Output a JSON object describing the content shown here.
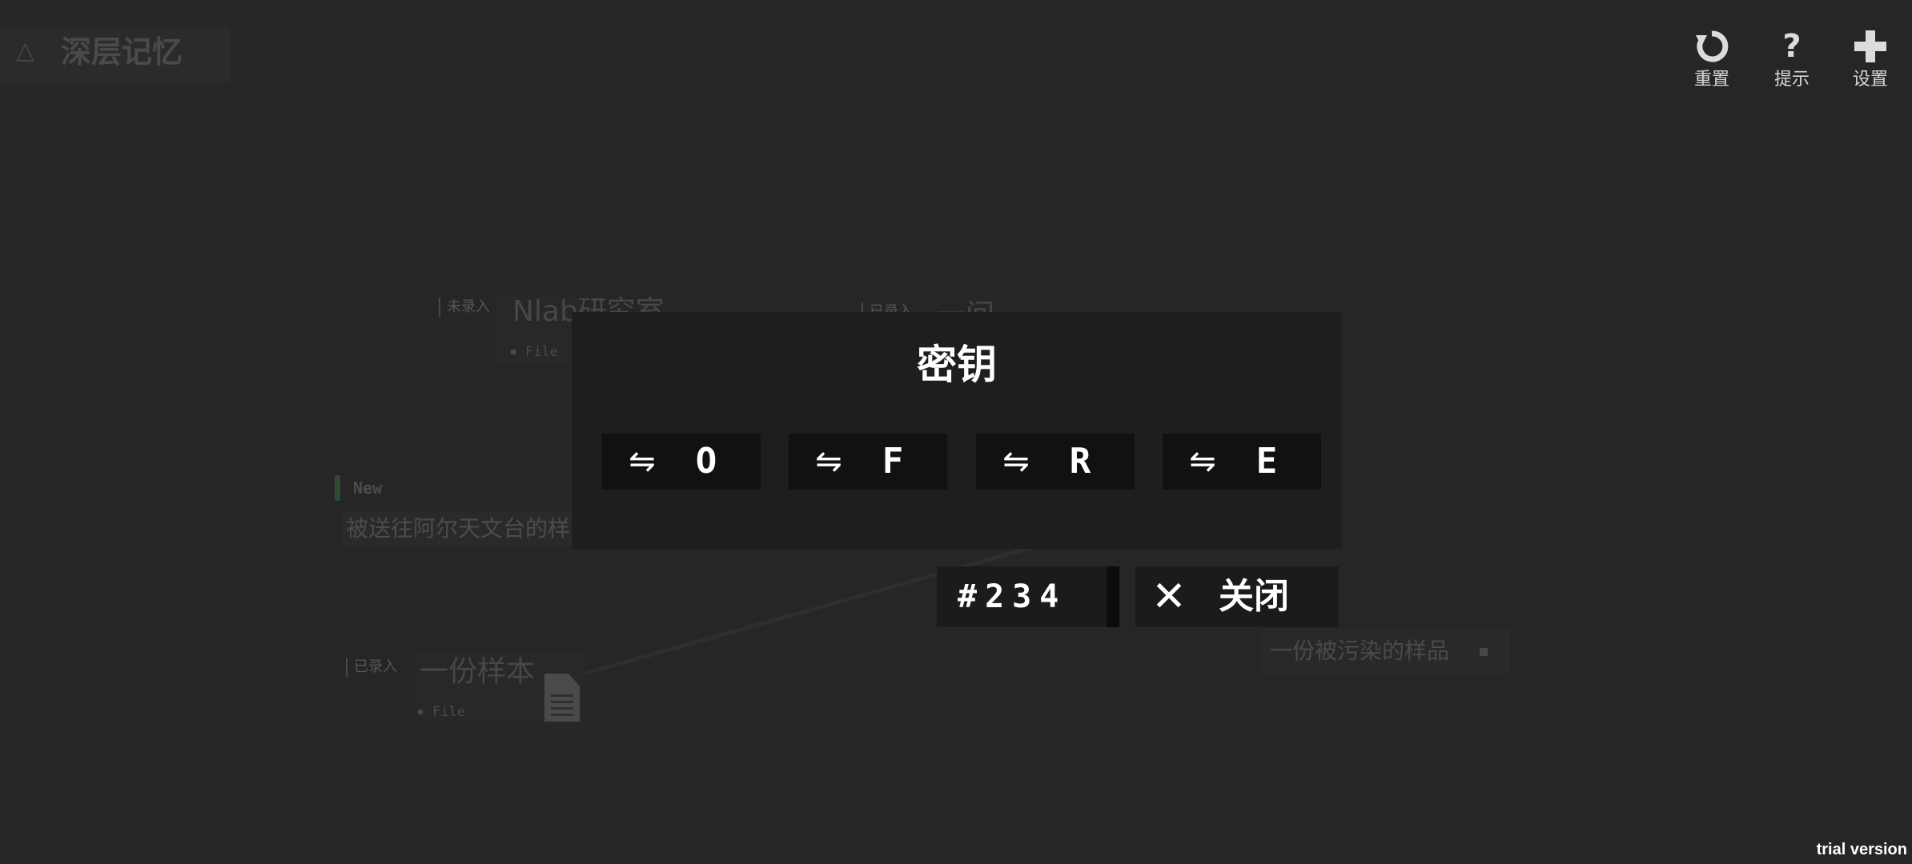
{
  "header": {
    "title": "深层记忆",
    "title_icon": "triangle-outline-icon"
  },
  "toolbar": {
    "reset_label": "重置",
    "hint_label": "提示",
    "settings_label": "设置",
    "reset_icon": "refresh-icon",
    "hint_icon": "question-icon",
    "settings_icon": "plus-icon"
  },
  "map": {
    "node_lab": {
      "tag": "未录入",
      "title": "Nlab研究室",
      "sub": "File"
    },
    "node_right": {
      "tag": "已录入",
      "title": "一间"
    },
    "node_new": {
      "tag": "New",
      "text": "被送往阿尔天文台的样"
    },
    "node_sample": {
      "tag": "已录入",
      "title": "一份样本",
      "sub": "File"
    },
    "node_contaminated": {
      "text": "一份被污染的样品"
    }
  },
  "dialog": {
    "title": "密钥",
    "slots": [
      {
        "arrow": "⇋",
        "letter": "O"
      },
      {
        "arrow": "⇋",
        "letter": "F"
      },
      {
        "arrow": "⇋",
        "letter": "R"
      },
      {
        "arrow": "⇋",
        "letter": "E"
      }
    ],
    "code": "#234",
    "close_symbol": "✕",
    "close_label": "关闭"
  },
  "watermark": "trial version",
  "colors": {
    "background": "#262626",
    "dialog_bg": "#1e1e1e",
    "slot_bg": "#111111",
    "text_white": "#ffffff",
    "dim_text": "#4a4a4a",
    "new_marker": "#2f4a2f"
  }
}
